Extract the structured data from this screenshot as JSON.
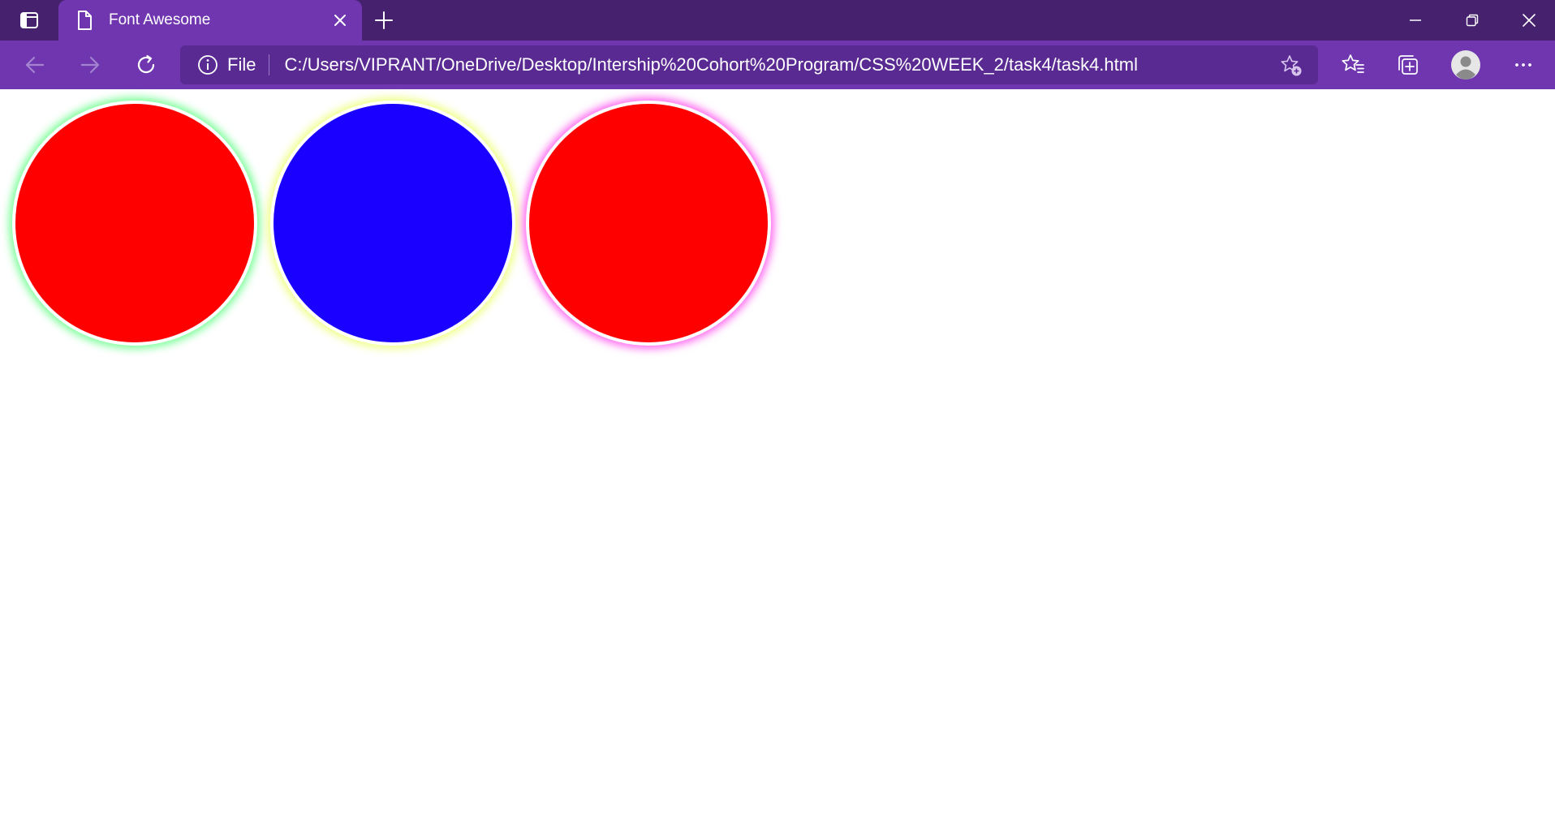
{
  "browser": {
    "tab": {
      "title": "Font Awesome"
    },
    "address": {
      "scheme": "File",
      "url": "C:/Users/VIPRANT/OneDrive/Desktop/Intership%20Cohort%20Program/CSS%20WEEK_2/task4/task4.html"
    },
    "icons": {
      "tab_actions": "tab-actions-icon",
      "page": "document-icon",
      "close_tab": "close-icon",
      "new_tab": "plus-icon",
      "back": "arrow-left-icon",
      "forward": "arrow-right-icon",
      "reload": "reload-icon",
      "site_info": "info-icon",
      "add_favorite": "star-plus-icon",
      "favorites": "favorites-icon",
      "collections": "collections-icon",
      "profile": "profile-icon",
      "more": "more-icon",
      "minimize": "minimize-icon",
      "maximize": "restore-icon",
      "close_window": "close-icon"
    },
    "colors": {
      "titlebar": "#46226e",
      "toolbar": "#6f36b0",
      "omnibox": "#5a2a93"
    }
  },
  "page": {
    "circles": [
      {
        "fill": "#ff0000",
        "glow": "#7dff9a"
      },
      {
        "fill": "#1a00ff",
        "glow": "#f0ff8a"
      },
      {
        "fill": "#ff0000",
        "glow": "#ff6cf0"
      }
    ]
  }
}
